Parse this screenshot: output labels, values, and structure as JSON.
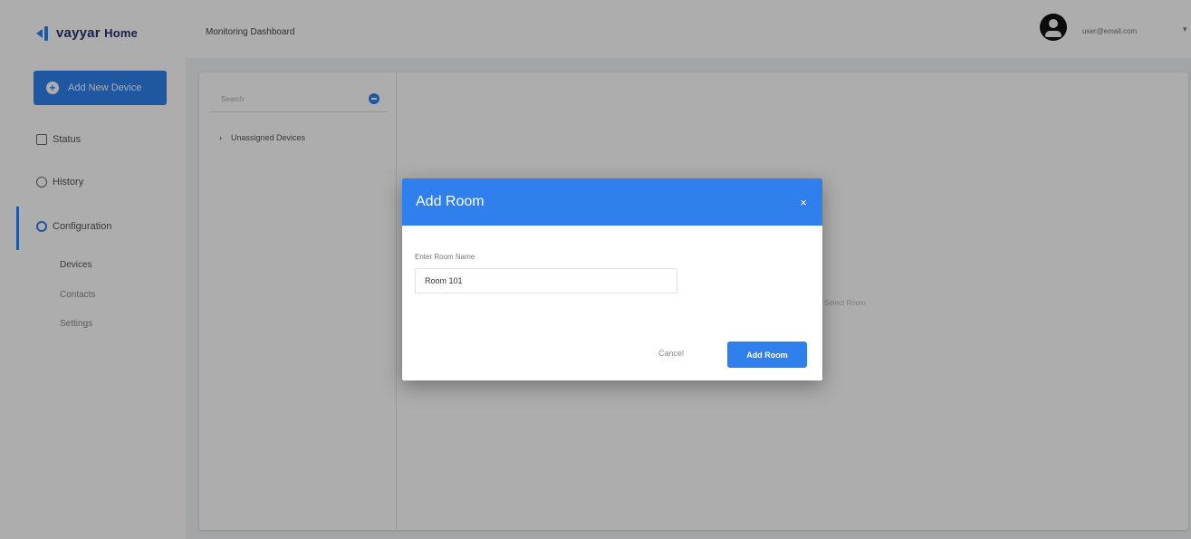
{
  "app": {
    "logo_text": "vayyar",
    "logo_sub": "Home"
  },
  "sidebar": {
    "add_device_label": "Add New Device",
    "items": [
      {
        "label": "Status"
      },
      {
        "label": "History"
      },
      {
        "label": "Configuration"
      }
    ],
    "sub_items": [
      {
        "label": "Devices"
      },
      {
        "label": "Contacts"
      },
      {
        "label": "Settings"
      }
    ]
  },
  "header": {
    "title": "Monitoring Dashboard",
    "user_name": "user@email.com",
    "chevron": "▾"
  },
  "tree": {
    "search_placeholder": "Search",
    "expand_glyph": "›",
    "unassigned_label": "Unassigned Devices"
  },
  "main": {
    "empty_text": "Select Room"
  },
  "dialog": {
    "title": "Add Room",
    "close_glyph": "×",
    "field_label": "Enter Room Name",
    "field_value": "Room 101",
    "cancel_label": "Cancel",
    "submit_label": "Add Room"
  },
  "colors": {
    "accent": "#2f80ed",
    "brand_dark": "#2b2f6b"
  }
}
